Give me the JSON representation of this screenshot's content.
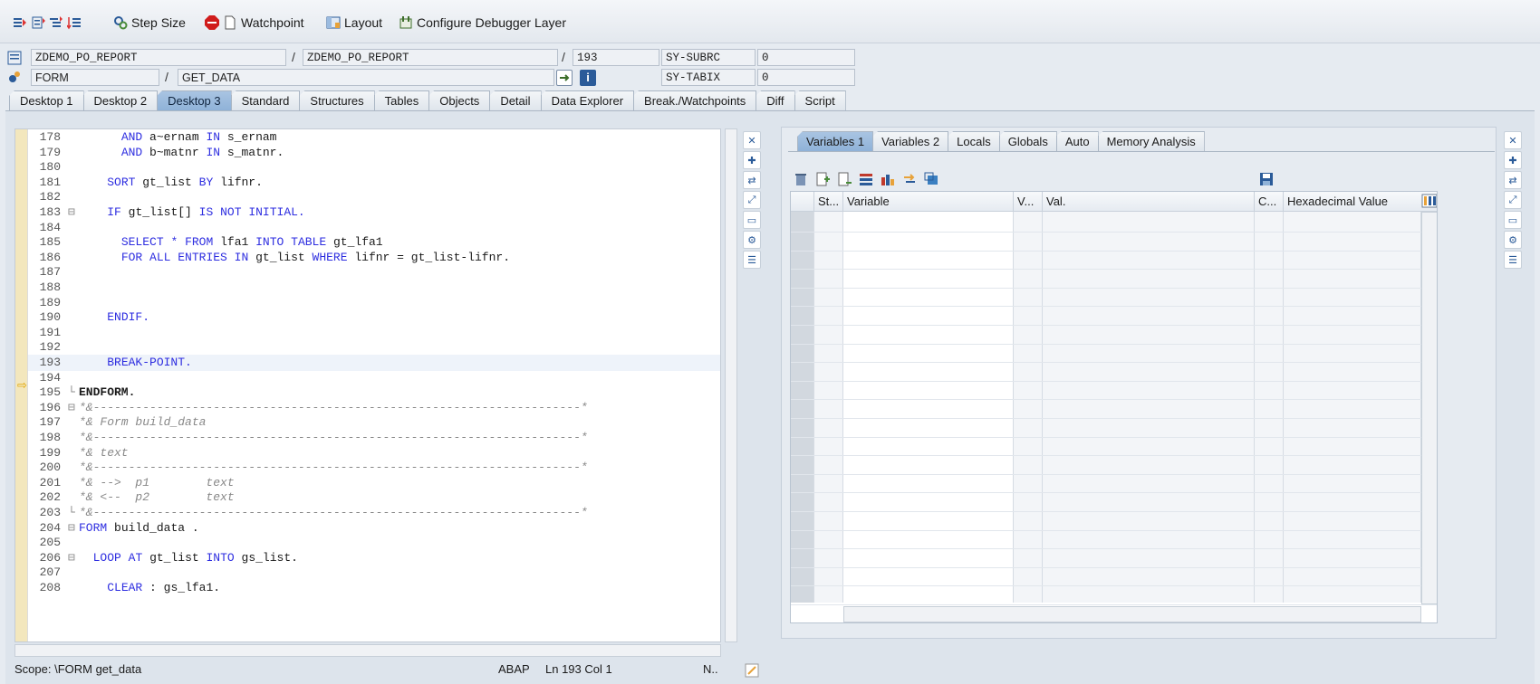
{
  "toolbar": {
    "step_size": "Step Size",
    "watchpoint": "Watchpoint",
    "layout": "Layout",
    "configure": "Configure Debugger Layer"
  },
  "header": {
    "program1": "ZDEMO_PO_REPORT",
    "program2": "ZDEMO_PO_REPORT",
    "line": "193",
    "subrc_label": "SY-SUBRC",
    "subrc_value": "0",
    "event_type": "FORM",
    "event_name": "GET_DATA",
    "tabix_label": "SY-TABIX",
    "tabix_value": "0"
  },
  "desktop_tabs": [
    "Desktop 1",
    "Desktop 2",
    "Desktop 3",
    "Standard",
    "Structures",
    "Tables",
    "Objects",
    "Detail",
    "Data Explorer",
    "Break./Watchpoints",
    "Diff",
    "Script"
  ],
  "active_desktop_tab": "Desktop 3",
  "code_lines": [
    {
      "n": "178",
      "fold": "",
      "text": "      AND a~ernam IN s_ernam",
      "style": "code"
    },
    {
      "n": "179",
      "fold": "",
      "text": "      AND b~matnr IN s_matnr.",
      "style": "code"
    },
    {
      "n": "180",
      "fold": "",
      "text": "",
      "style": "code"
    },
    {
      "n": "181",
      "fold": "",
      "text": "    SORT gt_list BY lifnr.",
      "style": "code"
    },
    {
      "n": "182",
      "fold": "",
      "text": "",
      "style": "code"
    },
    {
      "n": "183",
      "fold": "⊟",
      "text": "    IF gt_list[] IS NOT INITIAL.",
      "style": "code"
    },
    {
      "n": "184",
      "fold": "",
      "text": "",
      "style": "code"
    },
    {
      "n": "185",
      "fold": "",
      "text": "      SELECT * FROM lfa1 INTO TABLE gt_lfa1",
      "style": "code"
    },
    {
      "n": "186",
      "fold": "",
      "text": "      FOR ALL ENTRIES IN gt_list WHERE lifnr = gt_list-lifnr.",
      "style": "code"
    },
    {
      "n": "187",
      "fold": "",
      "text": "",
      "style": "code"
    },
    {
      "n": "188",
      "fold": "",
      "text": "",
      "style": "code"
    },
    {
      "n": "189",
      "fold": "",
      "text": "",
      "style": "code"
    },
    {
      "n": "190",
      "fold": "",
      "text": "    ENDIF.",
      "style": "code"
    },
    {
      "n": "191",
      "fold": "",
      "text": "",
      "style": "code"
    },
    {
      "n": "192",
      "fold": "",
      "text": "",
      "style": "code"
    },
    {
      "n": "193",
      "fold": "",
      "text": "    BREAK-POINT.",
      "style": "bp"
    },
    {
      "n": "194",
      "fold": "",
      "text": "",
      "style": "code"
    },
    {
      "n": "195",
      "fold": "└",
      "text": "ENDFORM.",
      "style": "bold"
    },
    {
      "n": "196",
      "fold": "⊟",
      "text": "*&---------------------------------------------------------------------*",
      "style": "cm"
    },
    {
      "n": "197",
      "fold": "",
      "text": "*& Form build_data",
      "style": "cm"
    },
    {
      "n": "198",
      "fold": "",
      "text": "*&---------------------------------------------------------------------*",
      "style": "cm"
    },
    {
      "n": "199",
      "fold": "",
      "text": "*& text",
      "style": "cm"
    },
    {
      "n": "200",
      "fold": "",
      "text": "*&---------------------------------------------------------------------*",
      "style": "cm"
    },
    {
      "n": "201",
      "fold": "",
      "text": "*& -->  p1        text",
      "style": "cm"
    },
    {
      "n": "202",
      "fold": "",
      "text": "*& <--  p2        text",
      "style": "cm"
    },
    {
      "n": "203",
      "fold": "└",
      "text": "*&---------------------------------------------------------------------*",
      "style": "cm"
    },
    {
      "n": "204",
      "fold": "⊟",
      "text": "FORM build_data .",
      "style": "code"
    },
    {
      "n": "205",
      "fold": "",
      "text": "",
      "style": "code"
    },
    {
      "n": "206",
      "fold": "⊟",
      "text": "  LOOP AT gt_list INTO gs_list.",
      "style": "code"
    },
    {
      "n": "207",
      "fold": "",
      "text": "",
      "style": "code"
    },
    {
      "n": "208",
      "fold": "",
      "text": "    CLEAR : gs_lfa1.",
      "style": "code"
    }
  ],
  "var_tabs": [
    "Variables 1",
    "Variables 2",
    "Locals",
    "Globals",
    "Auto",
    "Memory Analysis"
  ],
  "active_var_tab": "Variables 1",
  "grid_columns": [
    "St...",
    "Variable",
    "V...",
    "Val.",
    "C...",
    "Hexadecimal Value"
  ],
  "status": {
    "scope": "Scope: \\FORM get_data",
    "lang": "ABAP",
    "pos": "Ln 193 Col  1",
    "mode": "N.."
  }
}
